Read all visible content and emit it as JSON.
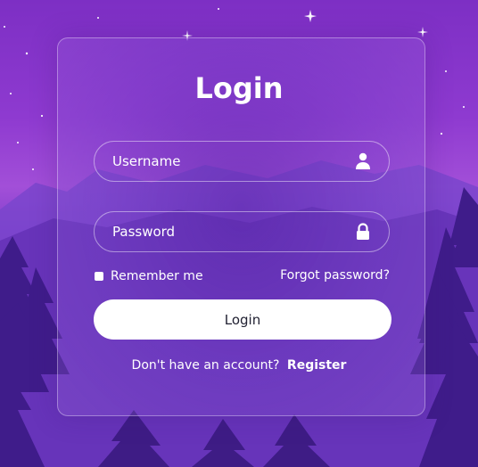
{
  "login": {
    "title": "Login",
    "username_placeholder": "Username",
    "password_placeholder": "Password",
    "remember_label": "Remember me",
    "forgot_label": "Forgot password?",
    "login_button_label": "Login",
    "no_account_text": "Don't have an account?",
    "register_label": "Register"
  },
  "icons": {
    "user": "user-icon",
    "lock": "lock-icon"
  },
  "colors": {
    "card_border": "#ffffff",
    "button_bg": "#ffffff",
    "button_text": "#222233",
    "text": "#ffffff"
  }
}
